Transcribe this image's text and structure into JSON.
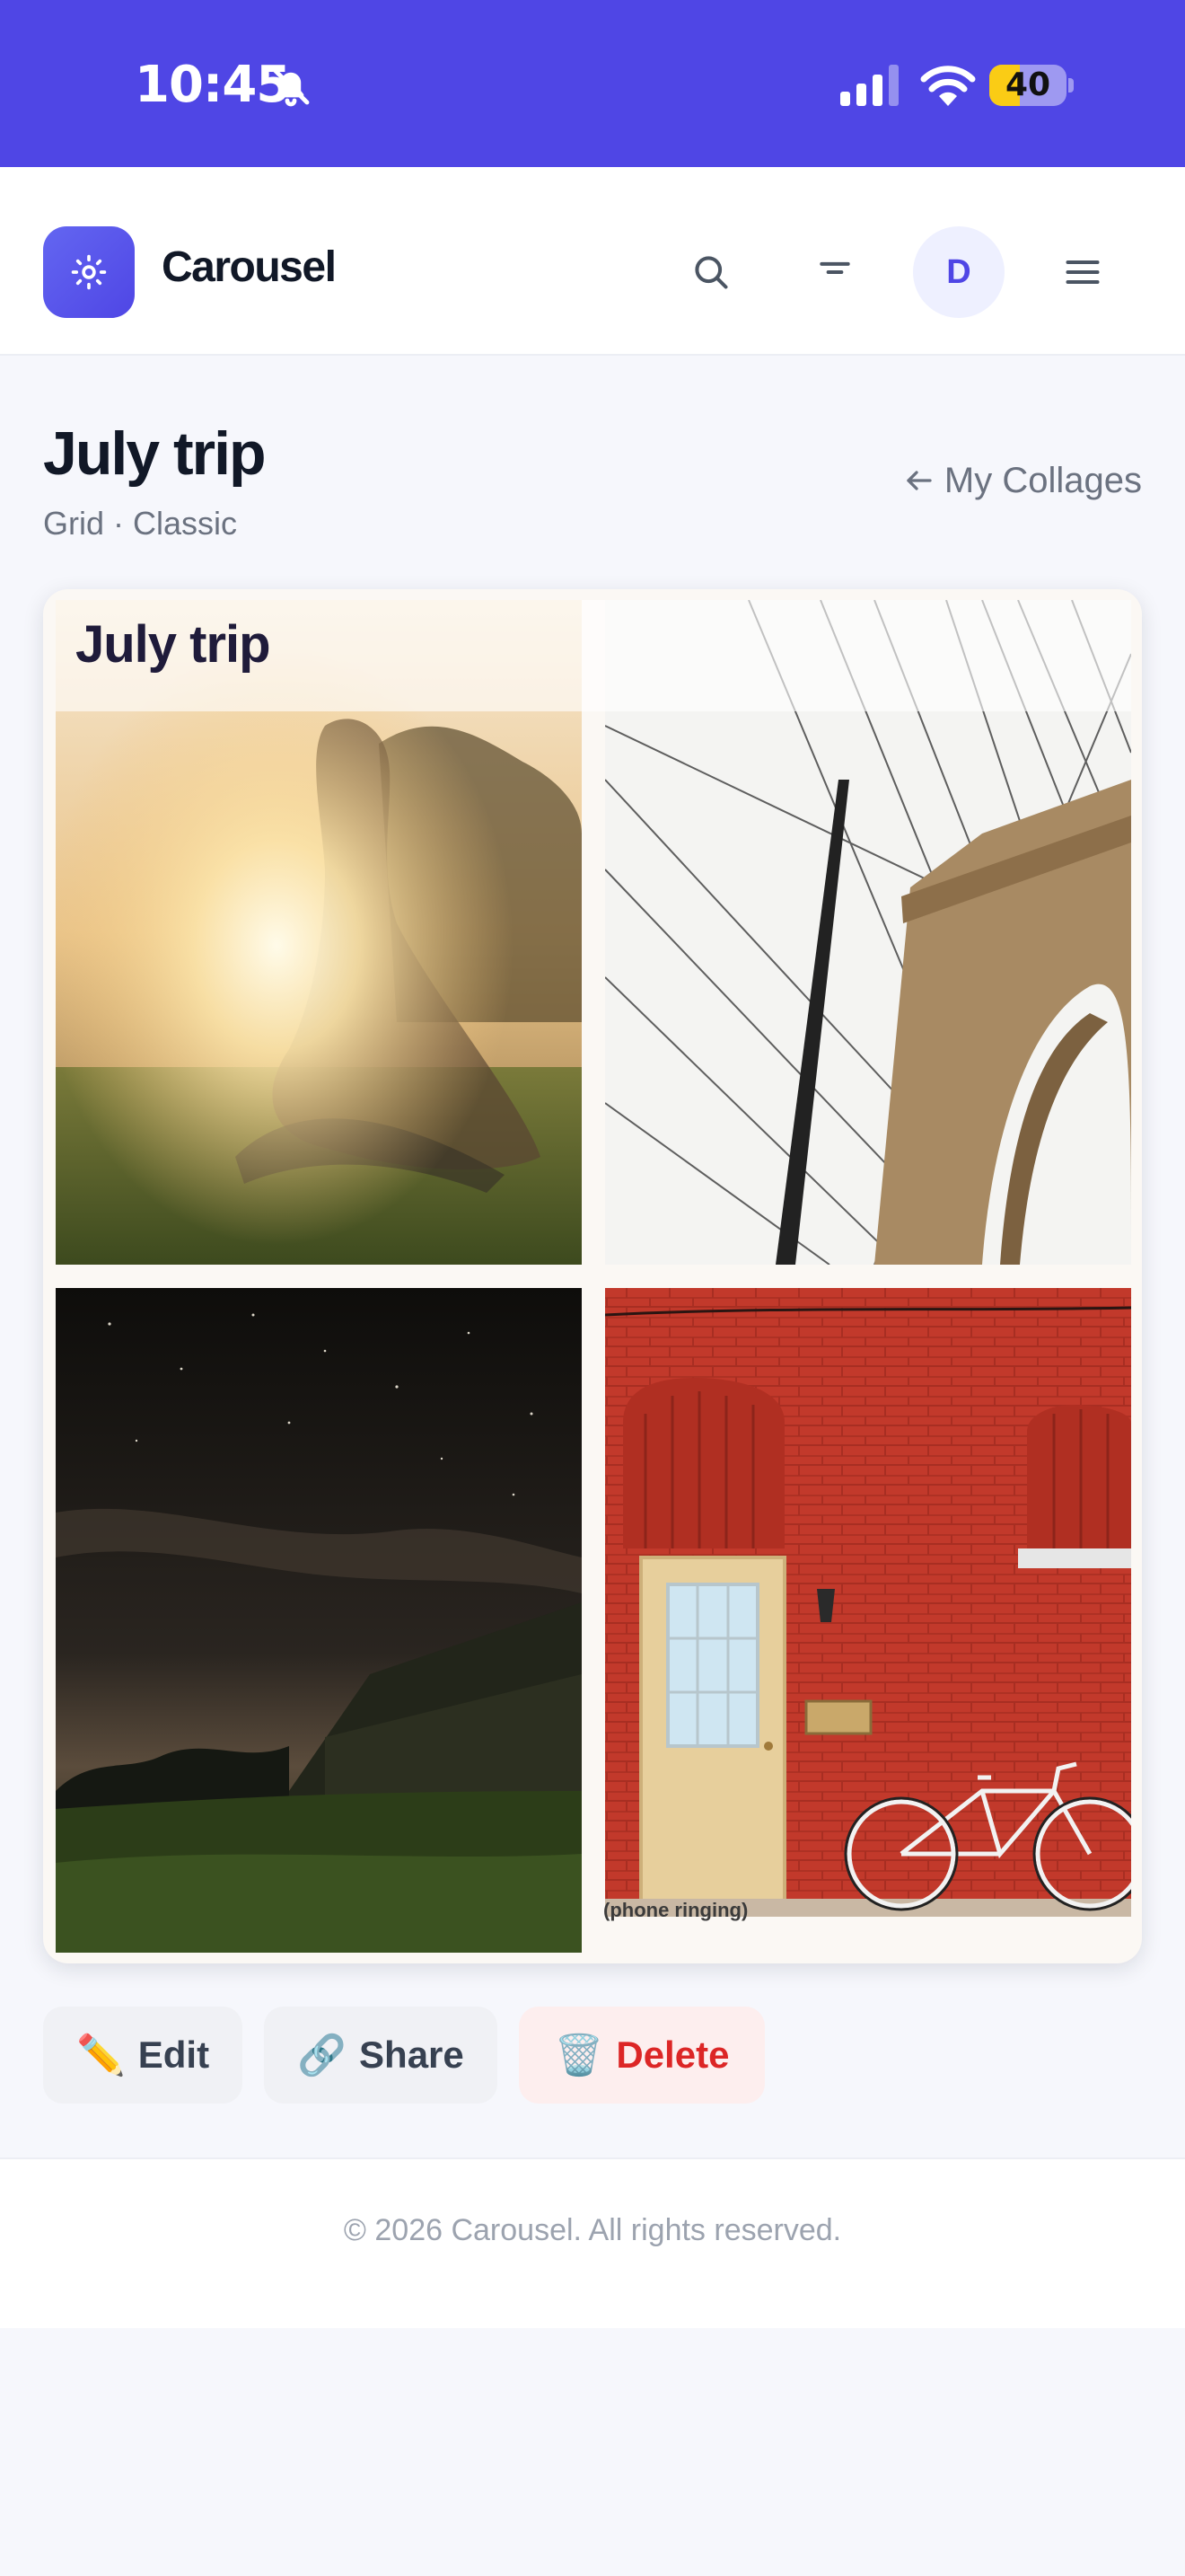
{
  "status_bar": {
    "time": "10:45",
    "battery": "40",
    "battery_level": 0.4,
    "icons": [
      "bell-slash-icon",
      "signal-icon",
      "wifi-icon",
      "battery-icon"
    ]
  },
  "header": {
    "brand": "Carousel",
    "avatar_initial": "D",
    "icons": [
      "logo-icon",
      "search-icon",
      "filter-icon",
      "menu-icon"
    ]
  },
  "page": {
    "title": "July trip",
    "subtitle": "Grid · Classic",
    "back_link": "My Collages"
  },
  "collage": {
    "overlay_title": "July trip",
    "caption": "(phone ringing)",
    "photos": [
      "girl-in-sunlit-meadow",
      "bridge-tower-and-cables",
      "barn-under-night-sky",
      "red-brick-wall-with-door-and-bicycle"
    ]
  },
  "actions": {
    "edit": {
      "emoji": "✏️",
      "label": "Edit"
    },
    "share": {
      "emoji": "🔗",
      "label": "Share"
    },
    "delete": {
      "emoji": "🗑️",
      "label": "Delete"
    }
  },
  "footer": {
    "text": "© 2026 Carousel. All rights reserved."
  },
  "colors": {
    "accent": "#4f46e5",
    "danger": "#dc2626",
    "background": "#f6f7fc"
  }
}
